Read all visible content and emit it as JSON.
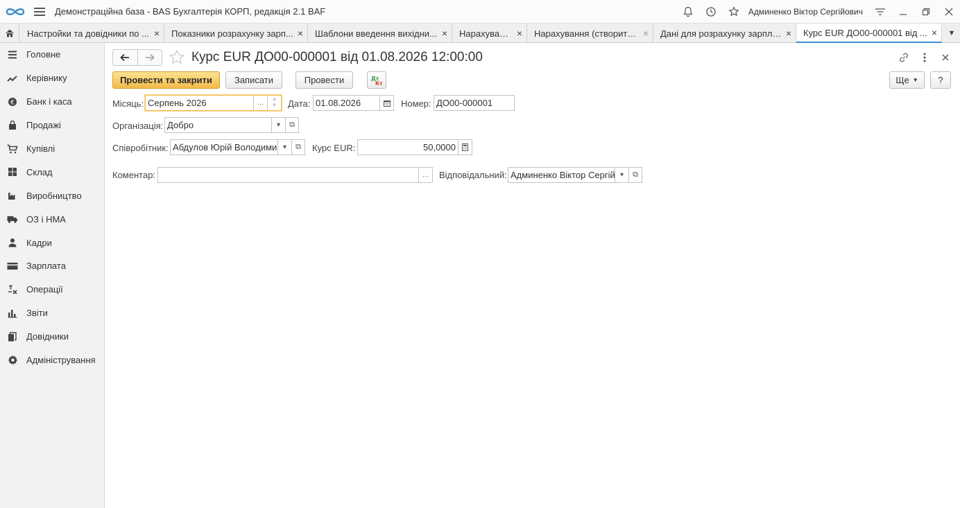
{
  "app": {
    "title": "Демонстраційна база - BAS Бухгалтерія КОРП, редакція 2.1 BAF",
    "user": "Админенко Віктор Сергійович"
  },
  "tabs": [
    {
      "label": "Настройки та довідники по ...",
      "close": "×"
    },
    {
      "label": "Показники розрахунку зарп...",
      "close": "×"
    },
    {
      "label": "Шаблони введення вихідни...",
      "close": "×"
    },
    {
      "label": "Нарахування",
      "close": "×"
    },
    {
      "label": "Нарахування (створити) *",
      "close": "×"
    },
    {
      "label": "Дані для розрахунку зарплати",
      "close": "×"
    },
    {
      "label": "Курс EUR ДО00-000001 від ...",
      "close": "×"
    }
  ],
  "sidebar": {
    "items": [
      {
        "label": "Головне",
        "icon": "menu-lines-icon"
      },
      {
        "label": "Керівнику",
        "icon": "trend-icon"
      },
      {
        "label": "Банк і каса",
        "icon": "coin-icon"
      },
      {
        "label": "Продажі",
        "icon": "bag-icon"
      },
      {
        "label": "Купівлі",
        "icon": "cart-icon"
      },
      {
        "label": "Склад",
        "icon": "warehouse-icon"
      },
      {
        "label": "Виробництво",
        "icon": "factory-icon"
      },
      {
        "label": "ОЗ і НМА",
        "icon": "truck-icon"
      },
      {
        "label": "Кадри",
        "icon": "person-icon"
      },
      {
        "label": "Зарплата",
        "icon": "card-icon"
      },
      {
        "label": "Операції",
        "icon": "operations-icon"
      },
      {
        "label": "Звіти",
        "icon": "bar-chart-icon"
      },
      {
        "label": "Довідники",
        "icon": "books-icon"
      },
      {
        "label": "Адміністрування",
        "icon": "gear-icon"
      }
    ]
  },
  "form": {
    "title": "Курс EUR ДО00-000001 від 01.08.2026 12:00:00",
    "toolbar": {
      "post_close": "Провести та закрити",
      "save": "Записати",
      "post": "Провести",
      "dtkt": "Дт Кт",
      "more": "Ще",
      "help": "?"
    },
    "month": {
      "label": "Місяць:",
      "value": "Серпень 2026"
    },
    "date": {
      "label": "Дата:",
      "value": "01.08.2026"
    },
    "number": {
      "label": "Номер:",
      "value": "ДО00-000001"
    },
    "organization": {
      "label": "Організація:",
      "value": "Добро"
    },
    "employee": {
      "label": "Співробітник:",
      "value": "Абдулов Юрій Володимир"
    },
    "rate": {
      "label": "Курс EUR:",
      "value": "50,0000"
    },
    "comment": {
      "label": "Коментар:",
      "value": ""
    },
    "responsible": {
      "label": "Відповідальний:",
      "value": "Админенко Віктор Сергійс"
    }
  },
  "colors": {
    "accent": "#3d8bd0",
    "primary_button": "#f3bb4c",
    "focus_border": "#f2b94b"
  }
}
